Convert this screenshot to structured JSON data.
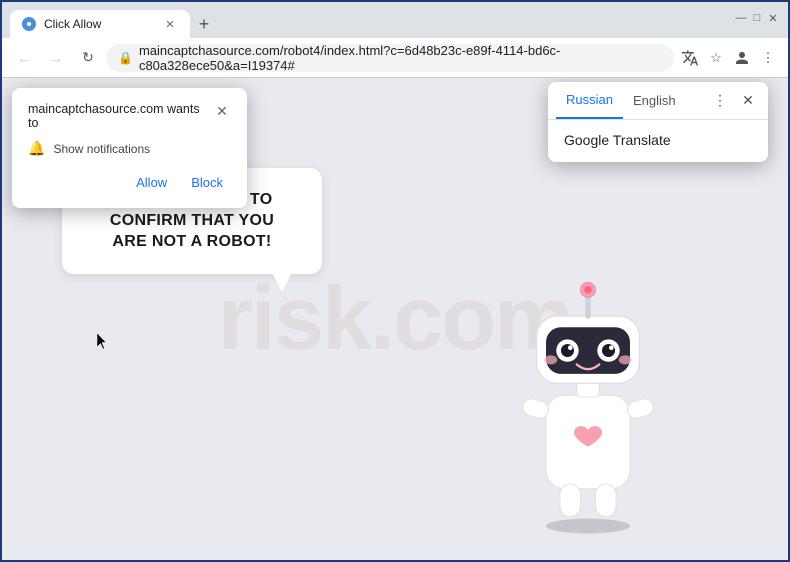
{
  "window": {
    "title": "Click Allow",
    "url": "maincaptchasource.com/robot4/index.html?c=6d48b23c-e89f-4114-bd6c-c80a328ece50&a=I19374#"
  },
  "tabs": [
    {
      "title": "Click Allow",
      "active": true
    }
  ],
  "notification_popup": {
    "title": "maincaptchasource.com wants to",
    "notification_text": "Show notifications",
    "allow_button": "Allow",
    "block_button": "Block"
  },
  "captcha": {
    "message_line1": "CLICK «ALLOW» TO CONFIRM THAT YOU",
    "message_line2": "ARE NOT A ROBOT!"
  },
  "translate_popup": {
    "tab_russian": "Russian",
    "tab_english": "English",
    "result": "Google Translate"
  },
  "watermark": {
    "text": "risk.com"
  },
  "icons": {
    "back": "←",
    "forward": "→",
    "refresh": "↻",
    "lock": "🔒",
    "star": "☆",
    "account": "👤",
    "more": "⋮",
    "translate": "🌐",
    "bell": "🔔",
    "close": "✕"
  }
}
